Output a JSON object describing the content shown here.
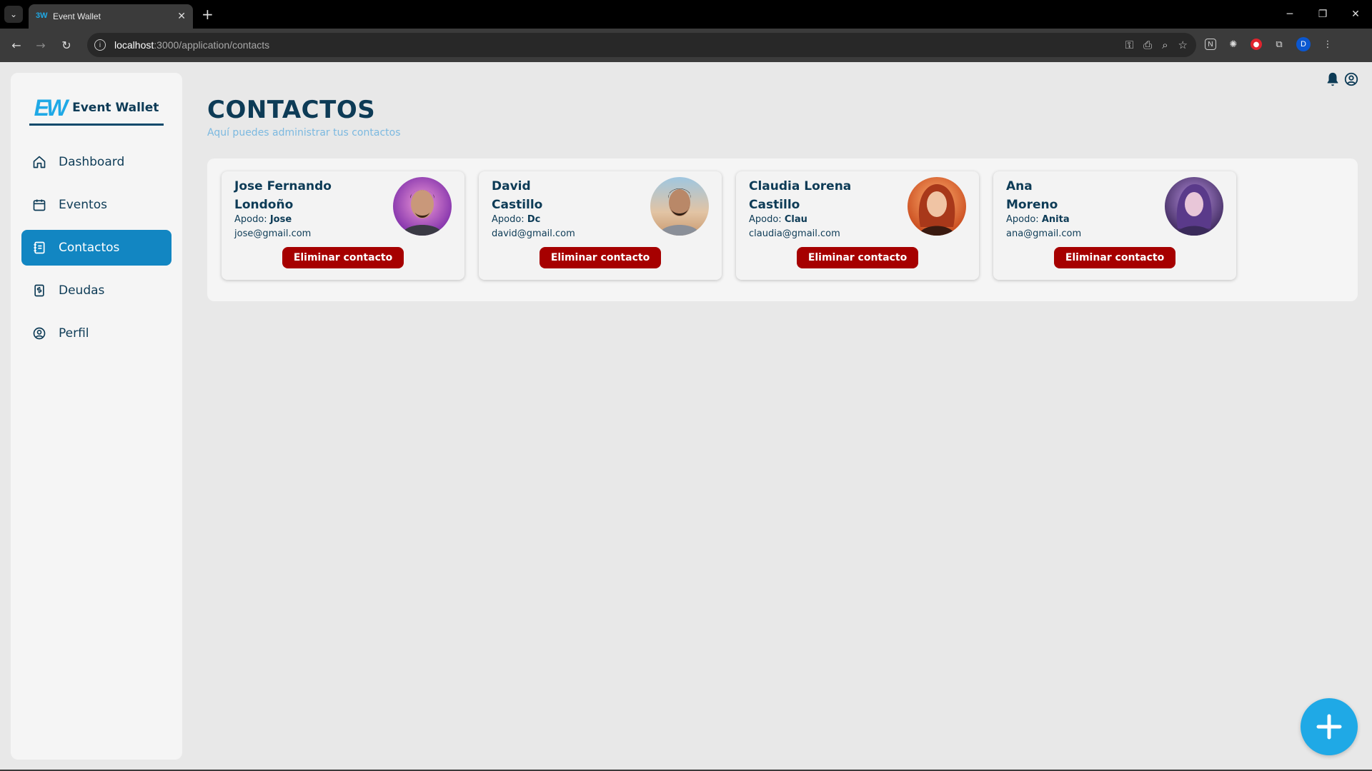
{
  "browser": {
    "tab_title": "Event Wallet",
    "url_host": "localhost",
    "url_path": ":3000/application/contacts",
    "profile_initial": "D"
  },
  "app": {
    "brand_logo": "EW",
    "brand_name": "Event Wallet",
    "accent_color": "#1fa9e6",
    "active_color": "#1286c2",
    "danger_color": "#a60000"
  },
  "sidebar": {
    "items": [
      {
        "label": "Dashboard",
        "icon": "home-icon"
      },
      {
        "label": "Eventos",
        "icon": "calendar-icon"
      },
      {
        "label": "Contactos",
        "icon": "contacts-icon",
        "active": true
      },
      {
        "label": "Deudas",
        "icon": "money-icon"
      },
      {
        "label": "Perfil",
        "icon": "user-circle-icon"
      }
    ]
  },
  "page": {
    "title": "CONTACTOS",
    "subtitle": "Aquí puedes administrar tus contactos"
  },
  "contacts": [
    {
      "name_line1": "Jose Fernando",
      "name_line2": "Londoño",
      "nick_label": "Apodo:",
      "nick": "Jose",
      "email": "jose@gmail.com",
      "button": "Eliminar contacto"
    },
    {
      "name_line1": "David",
      "name_line2": "Castillo",
      "nick_label": "Apodo:",
      "nick": "Dc",
      "email": "david@gmail.com",
      "button": "Eliminar contacto"
    },
    {
      "name_line1": "Claudia Lorena",
      "name_line2": "Castillo",
      "nick_label": "Apodo:",
      "nick": "Clau",
      "email": "claudia@gmail.com",
      "button": "Eliminar contacto"
    },
    {
      "name_line1": "Ana",
      "name_line2": "Moreno",
      "nick_label": "Apodo:",
      "nick": "Anita",
      "email": "ana@gmail.com",
      "button": "Eliminar contacto"
    }
  ]
}
